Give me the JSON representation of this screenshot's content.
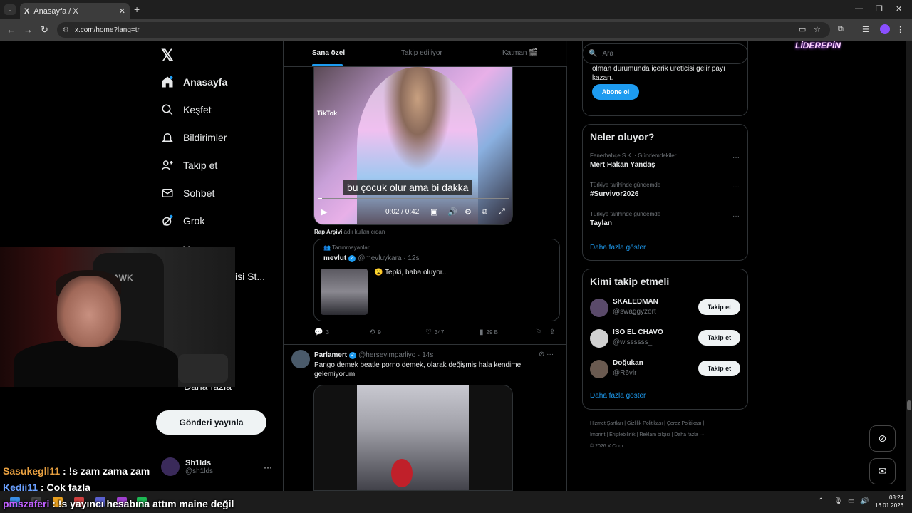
{
  "browser": {
    "tab_title": "Anasayfa / X",
    "tab_logo": "X",
    "url": "x.com/home?lang=tr",
    "menu_glyph": "⌄"
  },
  "nav": {
    "items": [
      {
        "label": "Anasayfa",
        "icon": "home-icon"
      },
      {
        "label": "Keşfet",
        "icon": "search-icon"
      },
      {
        "label": "Bildirimler",
        "icon": "bell-icon"
      },
      {
        "label": "Takip et",
        "icon": "person-add-icon"
      },
      {
        "label": "Sohbet",
        "icon": "mail-icon"
      },
      {
        "label": "Grok",
        "icon": "grok-icon"
      }
    ],
    "partial_item_1": "Y",
    "partial_item_2": "isi St...",
    "more_label": "Daha fazla",
    "post_button": "Gönderi yayınla",
    "profile_name": "Sh1lds",
    "profile_handle": "@sh1lds",
    "profile_more": "···"
  },
  "feed": {
    "tabs": [
      "Sana özel",
      "Takip ediliyor",
      "Katman 🎬"
    ],
    "video": {
      "watermark": "TikTok",
      "subtitle": "bu çocuk olur ama bi dakka",
      "time": "0:02 / 0:42",
      "progress_fraction": 0.02
    },
    "quote_by_name": "Rap Arşivi",
    "quote_by_suffix": " adlı kullanıcıdan",
    "quote": {
      "community": "Tanınmayanlar",
      "name": "mevlut",
      "handle": "@mevluykara · 12s",
      "text": "😮 Tepki, baba oluyor.."
    },
    "actions": {
      "replies": "3",
      "reposts": "9",
      "likes": "347",
      "views": "29 B"
    },
    "post2": {
      "name": "Parlamert",
      "handle": "@herseyimparliyo · 14s",
      "text": "Pango demek beatle porno demek, olarak değişmiş hala kendime gelemiyorum"
    }
  },
  "right": {
    "search_placeholder": "Ara",
    "premium_text": "olman durumunda içerik üreticisi gelir payı kazan.",
    "premium_button": "Abone ol",
    "trends_title": "Neler oluyor?",
    "trends": [
      {
        "context": "Fenerbahçe S.K. · Gündemdekiler",
        "name": "Mert Hakan Yandaş"
      },
      {
        "context": "Türkiye tarihinde gündemde",
        "name": "#Survivor2026"
      },
      {
        "context": "Türkiye tarihinde gündemde",
        "name": "Taylan"
      }
    ],
    "show_more": "Daha fazla göster",
    "wtf_title": "Kimi takip etmeli",
    "who_to_follow": [
      {
        "name": "SKALEDMAN",
        "handle": "@swaggyzort",
        "button": "Takip et"
      },
      {
        "name": "ISO EL CHAVO",
        "handle": "@wissssss_",
        "button": "Takip et"
      },
      {
        "name": "Doğukan",
        "handle": "@R6vlr",
        "button": "Takip et"
      }
    ],
    "wtf_more": "Daha fazla göster",
    "footer_line1": "Hizmet Şartları  |  Gizlilik Politikası  |  Çerez Politikası  |",
    "footer_line2": "Imprint  |  Erişilebilirlik  |  Reklam bilgisi  |  Daha fazla ···",
    "footer_line3": "© 2026 X Corp."
  },
  "overlay": {
    "brand": "LİDEREPİN",
    "chair_logo": "HAWK",
    "chat": [
      {
        "user": "Sasukegll11",
        "msg": " : !s zam zama zam"
      },
      {
        "user": "Kedii11",
        "msg": " : Cok fazla"
      },
      {
        "user": "pmszaferi",
        "msg": " : !s yayıncı hesabına attım maine değil"
      }
    ]
  },
  "taskbar": {
    "time": "03:24",
    "date": "16.01.2026"
  }
}
